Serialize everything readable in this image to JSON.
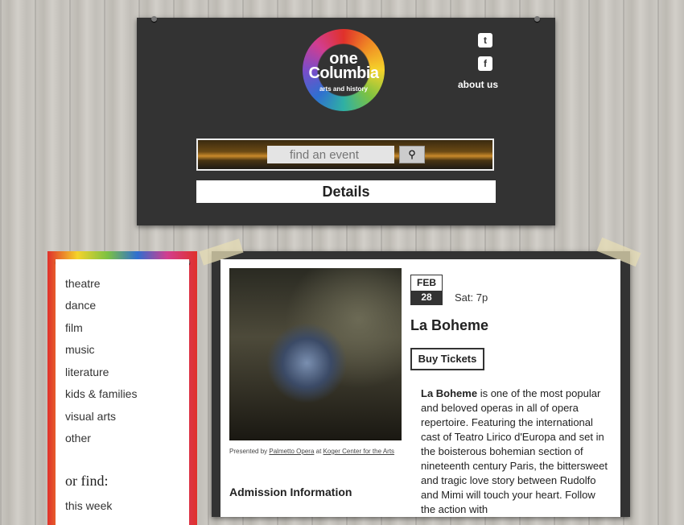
{
  "header": {
    "logo": {
      "line1": "one",
      "line2": "Columbia",
      "tagline": "arts and history"
    },
    "social": {
      "twitter_icon": "twitter-icon",
      "facebook_icon": "facebook-icon"
    },
    "about_label": "about us",
    "search": {
      "placeholder": "find an event",
      "button_icon": "search-icon"
    },
    "details_label": "Details"
  },
  "sidebar": {
    "categories": [
      "theatre",
      "dance",
      "film",
      "music",
      "literature",
      "kids & families",
      "visual arts",
      "other"
    ],
    "or_find_label": "or find:",
    "find_items": [
      "this week"
    ]
  },
  "event": {
    "date": {
      "month": "FEB",
      "day": "28"
    },
    "time": "Sat: 7p",
    "title": "La Boheme",
    "buy_label": "Buy Tickets",
    "caption": {
      "prefix": "Presented by",
      "presenter": "Palmetto Opera",
      "at": "at",
      "venue": "Koger Center for the Arts"
    },
    "admission_heading": "Admission Information",
    "description_bold": "La Boheme",
    "description_rest": " is one of the most popular and beloved operas in all of opera repertoire. Featuring the international cast of Teatro Lirico d'Europa and set in the boisterous bohemian section of nineteenth century Paris, the bittersweet and tragic love story between Rudolfo and Mimi will touch your heart. Follow the action with"
  }
}
